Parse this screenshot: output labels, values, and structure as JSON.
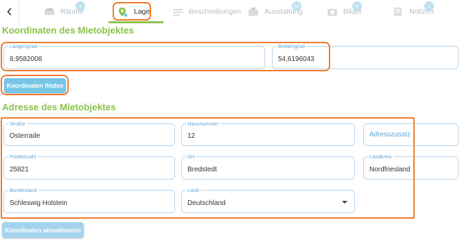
{
  "tabs": [
    {
      "label": "Räume",
      "badge": "1",
      "icon": "room-icon"
    },
    {
      "label": "Lage",
      "badge": "",
      "icon": "location-pin-icon"
    },
    {
      "label": "Beschreibungen",
      "badge": "",
      "icon": "description-icon"
    },
    {
      "label": "Ausstattung",
      "badge": "20",
      "icon": "equipment-icon"
    },
    {
      "label": "Bilder",
      "badge": "6",
      "icon": "camera-icon"
    },
    {
      "label": "Notizen",
      "badge": "1",
      "icon": "notes-icon"
    }
  ],
  "colors": {
    "accent": "#8bc34a",
    "primary": "#79c5e6",
    "highlight": "#f07a2a",
    "field_label": "#5fa3d6"
  },
  "coords": {
    "title": "Koordinaten des Mietobjektes",
    "lng_label": "Längengrad",
    "lng_value": "8,9582008",
    "lat_label": "Breitengrad",
    "lat_value": "54,6196043",
    "find_button": "Koordinaten finden"
  },
  "address": {
    "title": "Adresse des Mietobjektes",
    "street_label": "Straße",
    "street_value": "Osterrade",
    "number_label": "Hausnummer",
    "number_value": "12",
    "extra_placeholder": "Adresszusatz",
    "zip_label": "Postleitzahl",
    "zip_value": "25821",
    "city_label": "Ort",
    "city_value": "Bredstedt",
    "district_label": "Landkreis",
    "district_value": "Nordfriesland",
    "state_label": "Bundesland",
    "state_value": "Schleswig Holstein",
    "country_label": "Land",
    "country_value": "Deutschland",
    "update_button": "Koordinaten aktualisieren"
  }
}
